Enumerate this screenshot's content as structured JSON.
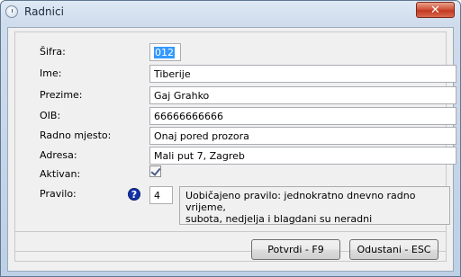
{
  "window": {
    "title": "Radnici",
    "close_label": "✕"
  },
  "form": {
    "sifra": {
      "label": "Šifra:",
      "value": "012"
    },
    "ime": {
      "label": "Ime:",
      "value": "Tiberije"
    },
    "prezime": {
      "label": "Prezime:",
      "value": "Gaj Grahko"
    },
    "oib": {
      "label": "OIB:",
      "value": "66666666666"
    },
    "radno_mjesto": {
      "label": "Radno mjesto:",
      "value": "Onaj pored prozora"
    },
    "adresa": {
      "label": "Adresa:",
      "value": "Mali put 7, Zagreb"
    },
    "aktivan": {
      "label": "Aktivan:",
      "checked": true
    },
    "pravilo": {
      "label": "Pravilo:",
      "value": "4",
      "help_icon": "question-icon",
      "description_line1": "Uobičajeno pravilo: jednokratno dnevno radno vrijeme,",
      "description_line2": "subota, nedjelja i blagdani su neradni"
    }
  },
  "buttons": {
    "confirm": "Potvrdi - F9",
    "cancel": "Odustani - ESC"
  },
  "colors": {
    "selection": "#3399ff",
    "help_icon": "#1232a8",
    "close_button": "#c23a22"
  }
}
